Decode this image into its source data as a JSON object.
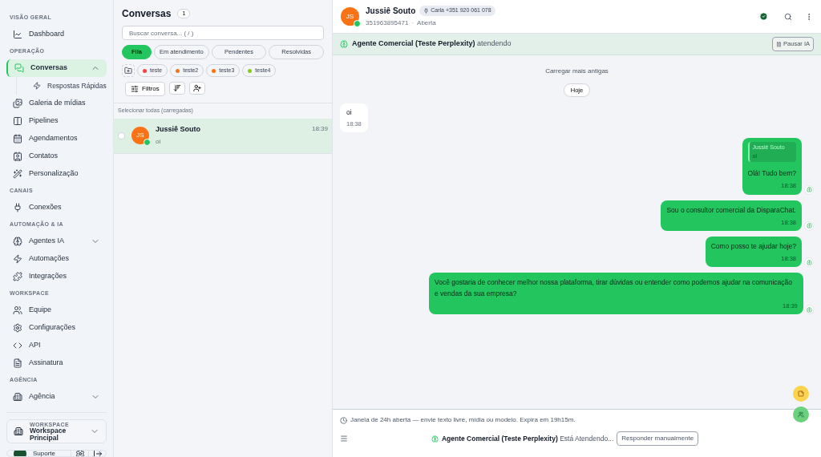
{
  "sidebar": {
    "sections": [
      {
        "title": "VISÃO GERAL",
        "items": [
          {
            "label": "Dashboard",
            "selected": false
          }
        ]
      },
      {
        "title": "OPERAÇÃO",
        "items": [
          {
            "label": "Conversas",
            "selected": true,
            "expanded": true,
            "children": [
              {
                "label": "Respostas Rápidas",
                "selected": false
              }
            ]
          },
          {
            "label": "Galeria de mídias",
            "selected": false
          },
          {
            "label": "Pipelines",
            "selected": false
          },
          {
            "label": "Agendamentos",
            "selected": false
          },
          {
            "label": "Contatos",
            "selected": false
          },
          {
            "label": "Personalização",
            "selected": false
          }
        ]
      },
      {
        "title": "CANAIS",
        "items": [
          {
            "label": "Conexões",
            "selected": false
          }
        ]
      },
      {
        "title": "AUTOMAÇÃO & IA",
        "items": [
          {
            "label": "Agentes IA",
            "selected": false,
            "expanded": false
          },
          {
            "label": "Automações",
            "selected": false
          },
          {
            "label": "Integrações",
            "selected": false
          }
        ]
      },
      {
        "title": "WORKSPACE",
        "items": [
          {
            "label": "Equipe",
            "selected": false
          },
          {
            "label": "Configurações",
            "selected": false
          },
          {
            "label": "API",
            "selected": false
          },
          {
            "label": "Assinatura",
            "selected": false
          }
        ]
      },
      {
        "title": "AGÊNCIA",
        "items": [
          {
            "label": "Agência",
            "selected": false,
            "expanded": false
          }
        ]
      }
    ],
    "workspace": {
      "label": "WORKSPACE",
      "value": "Workspace Principal"
    },
    "user": {
      "name": "Suporte"
    }
  },
  "list": {
    "title": "Conversas",
    "count": "1",
    "search": {
      "placeholder": "Buscar conversa... ( / )"
    },
    "tabs": [
      {
        "label": "Fila",
        "selected": true
      },
      {
        "label": "Em atendimento",
        "selected": false
      },
      {
        "label": "Pendentes",
        "selected": false
      },
      {
        "label": "Resolvidas",
        "selected": false
      }
    ],
    "tags": [
      {
        "label": "teste",
        "color": "#ef4444"
      },
      {
        "label": "teste2",
        "color": "#f97316"
      },
      {
        "label": "teste3",
        "color": "#f97316"
      },
      {
        "label": "teste4",
        "color": "#84cc16"
      }
    ],
    "filters_button": "Filtros",
    "select_all": "Selecionar todas (carregadas)",
    "conversations": [
      {
        "initials": "JS",
        "name": "Jussiê Souto",
        "time": "18:39",
        "preview": "oi",
        "selected": true,
        "checked": false
      }
    ]
  },
  "chat": {
    "contact": {
      "initials": "JS",
      "name": "Jussiê Souto",
      "channel": "Carla +351 920 061 078",
      "phone": "351963895471",
      "separator": "·",
      "status": "Aberta"
    },
    "ai_banner": {
      "agent": "Agente Comercial (Teste Perplexity)",
      "state": "atendendo",
      "button": "Pausar IA"
    },
    "load_older": "Carregar mais antigas",
    "date": "Hoje",
    "messages": [
      {
        "kind": "incoming",
        "text": "oi",
        "time": "18:38"
      },
      {
        "kind": "outgoing",
        "quote": {
          "author": "Jussiê Souto",
          "text": "oi"
        },
        "text": "Olá! Tudo bem?",
        "time": "18:38"
      },
      {
        "kind": "outgoing",
        "text": "Sou o consultor comercial da DisparaChat.",
        "time": "18:38"
      },
      {
        "kind": "outgoing",
        "text": "Como posso te ajudar hoje?",
        "time": "18:38"
      },
      {
        "kind": "outgoing",
        "text": "Você gostaria de conhecer melhor nossa plataforma, tirar dúvidas ou entender como podemos ajudar na comunicação e vendas da sua empresa?",
        "time": "18:39"
      }
    ],
    "window_note": "Janela de 24h aberta — envie texto livre, mídia ou modelo. Expira em 19h15m.",
    "footer": {
      "agent": "Agente Comercial (Teste Perplexity)",
      "state": "Está Atendendo...",
      "button": "Responder manualmente"
    }
  }
}
